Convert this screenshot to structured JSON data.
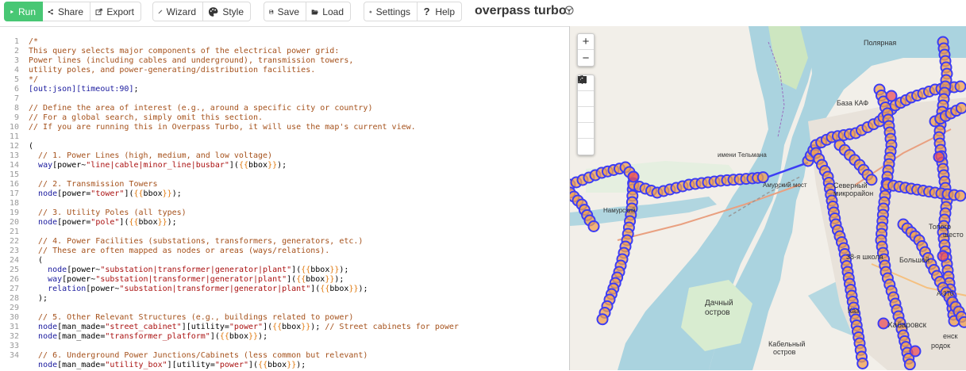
{
  "toolbar": {
    "run": "Run",
    "share": "Share",
    "export": "Export",
    "wizard": "Wizard",
    "style": "Style",
    "save": "Save",
    "load": "Load",
    "settings": "Settings",
    "help": "Help",
    "app_title": "overpass turbo"
  },
  "colors": {
    "run_button": "#48c774",
    "comment": "#a5511b",
    "keyword": "#1a1a9e",
    "string": "#aa1111",
    "bbox": "#e07a10",
    "map_water": "#aad3df",
    "map_marker_stroke": "#3c3cf5",
    "map_marker_fill": "#f0a050"
  },
  "editor": {
    "line_numbers": [
      "1",
      "2",
      "3",
      "4",
      "5",
      "6",
      "7",
      "8",
      "9",
      "10",
      "11",
      "12",
      "13",
      "14",
      "15",
      "16",
      "17",
      "18",
      "19",
      "20",
      "21",
      "22",
      "23",
      "24",
      "25",
      "26",
      "27",
      "28",
      "29",
      "30",
      "31",
      "32",
      "33",
      "34"
    ]
  },
  "map": {
    "zoom_in": "+",
    "zoom_out": "−",
    "labels": {
      "polyarnaya": "Полярная",
      "baza_kaf": "База КАФ",
      "imeni_telmana": "имени Тельмана",
      "amursky_most": "Амурский мост",
      "severny": "Северный",
      "mikrorayon": "микрорайон",
      "namursky": "Намурский",
      "topograf": "Топогр",
      "shkola": "38-я школа",
      "bolshoy": "Большой",
      "a370": "А-370",
      "dachny_1": "Дачный",
      "dachny_2": "остров",
      "khabarovsk": "Хабаровск",
      "kabelny_1": "Кабельный",
      "kabelny_2": "остров",
      "gorodok": "родок",
      "ensk": "енск",
      "kaz": "Каз",
      "shesto": "шесто"
    }
  }
}
